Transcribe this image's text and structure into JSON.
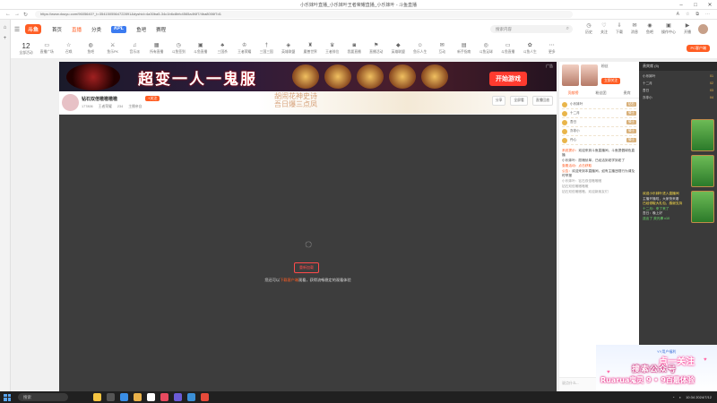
{
  "window": {
    "title": "小乐妹叶直播_小乐妹叶王者荣耀直播_小乐妹叶 - 斗鱼直播",
    "controls": [
      "–",
      "□",
      "✕"
    ]
  },
  "browser": {
    "url": "https://www.douyu.com/9605640?_t=3541505564722891&dyshid=4a30ba5-34c1b6c8bfc4565a4f4f7/4ba8006f7d1",
    "side_icons": [
      "⌂",
      "+"
    ],
    "tool_icons": [
      "A",
      "☆",
      "⧉",
      "⋯"
    ]
  },
  "site": {
    "logo": "斗鱼",
    "nav": [
      {
        "label": "首页",
        "active": false
      },
      {
        "label": "直播",
        "active": true
      },
      {
        "label": "分类",
        "active": false
      },
      {
        "label": "KPL",
        "active": false,
        "special": true
      },
      {
        "label": "鱼吧",
        "active": false
      },
      {
        "label": "赛程",
        "active": false
      }
    ],
    "search_placeholder": "搜索内容",
    "header_icons": [
      {
        "label": "历史",
        "glyph": "◷"
      },
      {
        "label": "关注",
        "glyph": "♡"
      },
      {
        "label": "下载",
        "glyph": "⇩"
      },
      {
        "label": "消息",
        "glyph": "✉"
      },
      {
        "label": "鱼吧",
        "glyph": "◉"
      },
      {
        "label": "操作中心",
        "glyph": "▣"
      },
      {
        "label": "开播",
        "glyph": "▶"
      }
    ]
  },
  "categories": {
    "date_day": "12",
    "date_label": "全部活动",
    "items": [
      "直播广场",
      "召唤",
      "鱼吧",
      "鱼乐PK",
      "音乐派",
      "所有直播",
      "斗鱼签到",
      "斗鱼直播",
      "三国杀",
      "王者荣耀",
      "三国三国",
      "英雄联盟",
      "魔兽世界",
      "王者排位",
      "我要直播",
      "直播活动",
      "英雄联盟",
      "鱼乐人生",
      "互动",
      "新手指南",
      "斗鱼足球",
      "斗鱼直播",
      "斗鱼人生",
      "更多"
    ],
    "pc_app": "PC客户端"
  },
  "banner": {
    "title": "超变一人一鬼服",
    "start_button": "开始游戏",
    "ad_label": "广告"
  },
  "room": {
    "name": "钻石双倍嗷嗷嗷嗷",
    "follow": "+关注",
    "meta": [
      "177806",
      "王者荣耀",
      "234",
      "主播亲自"
    ],
    "deco_line1": "胡闹花神史诗",
    "deco_line2": "吾日爆三点凤",
    "buttons": [
      "分享",
      "全屏看",
      "直播回放"
    ]
  },
  "player": {
    "spinner": "◌",
    "retry": "重新加载",
    "message_prefix": "您还可以",
    "message_highlight": "下载客户端",
    "message_suffix": "观看，获得流畅稳定的观看体验"
  },
  "chat": {
    "anchor_info": "粉丝",
    "anchor_btn": "立即关注",
    "tabs": [
      {
        "label": "贡献榜",
        "on": true
      },
      {
        "label": "粉丝团",
        "on": false
      },
      {
        "label": "贵宾",
        "on": false
      }
    ],
    "rank_rows": [
      {
        "name": "小乐妹叶",
        "badge": "钻石"
      },
      {
        "name": "十二月",
        "badge": "骑士"
      },
      {
        "name": "吾日",
        "badge": "骑士"
      },
      {
        "name": "亦非小",
        "badge": "骑士"
      },
      {
        "name": "丹心",
        "badge": "骑士"
      }
    ],
    "messages": [
      {
        "sys": "系统提示：",
        "text": "欢迎来到斗鱼直播间，斗鱼提倡绿色直播"
      },
      {
        "sys": "",
        "text": "小乐妹叶：愿赌伏单，已经活到老学到老了"
      },
      {
        "sys": "",
        "text": "查看活动：点击获取"
      },
      {
        "sys": "公告：",
        "text": "欢迎来到本直播间，如有主播违规行为请及时举报"
      },
      {
        "sys": "",
        "text": "小乐妹叶：钻石双倍嗷嗷嗷"
      },
      {
        "sys": "",
        "text": "钻石双倍嗷嗷嗷嗷"
      },
      {
        "sys": "",
        "text": "钻石双倍嗷嗷嗷，欢迎新朋友们"
      }
    ],
    "input_placeholder": "说点什么..."
  },
  "farpanel": {
    "header": "贵宾席 (5)",
    "rows": [
      {
        "name": "小乐妹叶",
        "rank": "01"
      },
      {
        "name": "十二月",
        "rank": "02"
      },
      {
        "name": "吾日",
        "rank": "03"
      },
      {
        "name": "亦非小",
        "rank": "04"
      }
    ],
    "messages": [
      {
        "cls": "hl",
        "text": "欢迎小乐妹叶进入直播间"
      },
      {
        "cls": "",
        "text": "主播开播啦，大家快来看"
      },
      {
        "cls": "hl",
        "text": "已经领取大礼包，感谢支持"
      },
      {
        "cls": "gr",
        "text": "十二月：来了来了"
      },
      {
        "cls": "",
        "text": "吾日：晚上好"
      },
      {
        "cls": "gr",
        "text": "送出了 荧光棒 x10"
      }
    ]
  },
  "overlay": {
    "yy": "YY用户福利",
    "cute": "点一关注",
    "big": "搜索公众号",
    "sub": "Ruarua鬼灵 9 • 9百最体验"
  },
  "taskbar": {
    "search": "搜索",
    "time": "10:34",
    "date": "2024/7/12"
  }
}
